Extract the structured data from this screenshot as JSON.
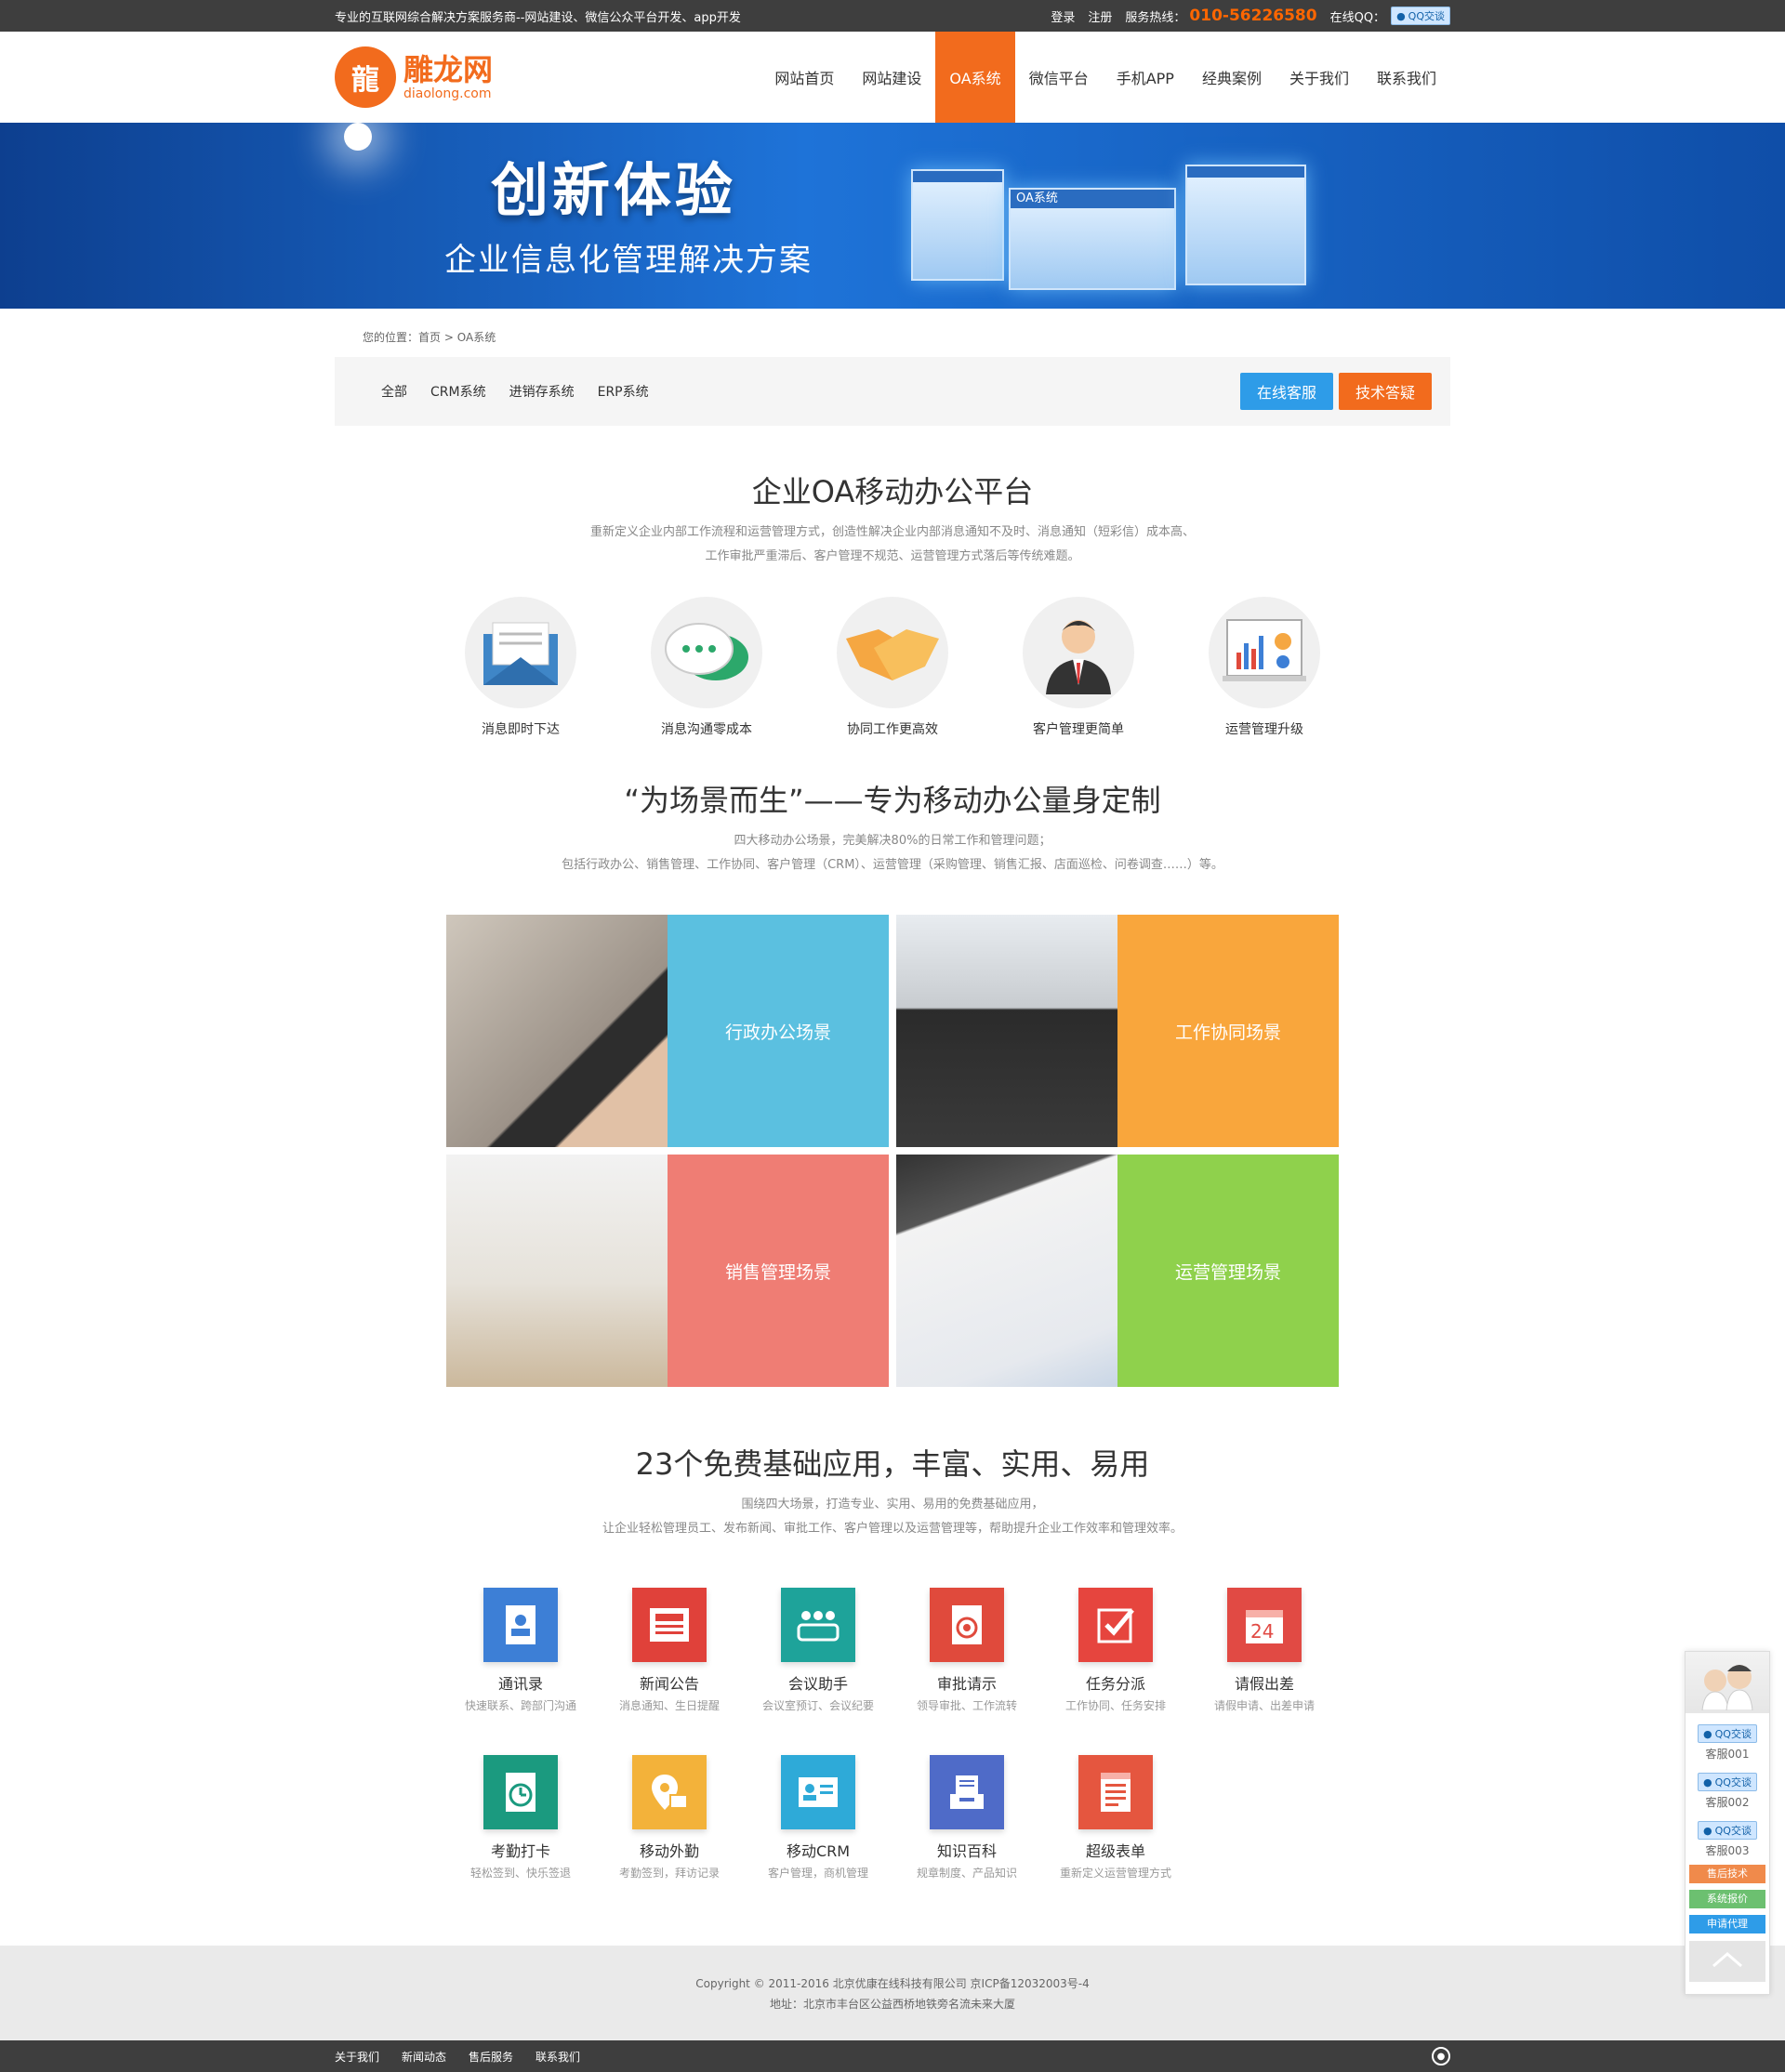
{
  "topbar": {
    "slogan": "专业的互联网综合解决方案服务商--网站建设、微信公众平台开发、app开发",
    "login": "登录",
    "register": "注册",
    "hotline_label": "服务热线：",
    "hotline": "010-56226580",
    "qq_label": "在线QQ：",
    "qq_badge": "QQ交谈"
  },
  "logo": {
    "cn": "雕龙网",
    "en": "diaolong.com"
  },
  "nav": [
    {
      "label": "网站首页"
    },
    {
      "label": "网站建设"
    },
    {
      "label": "OA系统"
    },
    {
      "label": "微信平台"
    },
    {
      "label": "手机APP"
    },
    {
      "label": "经典案例"
    },
    {
      "label": "关于我们"
    },
    {
      "label": "联系我们"
    }
  ],
  "banner": {
    "title": "创新体验",
    "subtitle": "企业信息化管理解决方案",
    "screen_label": "OA系统"
  },
  "breadcrumb": {
    "prefix": "您的位置：",
    "home": "首页",
    "sep": ">",
    "current": "OA系统"
  },
  "tabs": [
    {
      "label": "全部"
    },
    {
      "label": "CRM系统"
    },
    {
      "label": "进销存系统"
    },
    {
      "label": "ERP系统"
    }
  ],
  "buttons": {
    "online_service": "在线客服",
    "tech_support": "技术答疑"
  },
  "section1": {
    "title": "企业OA移动办公平台",
    "desc1": "重新定义企业内部工作流程和运营管理方式，创造性解决企业内部消息通知不及时、消息通知（短彩信）成本高、",
    "desc2": "工作审批严重滞后、客户管理不规范、运营管理方式落后等传统难题。"
  },
  "features": [
    {
      "label": "消息即时下达",
      "icon": "envelope-icon"
    },
    {
      "label": "消息沟通零成本",
      "icon": "chat-bubble-icon"
    },
    {
      "label": "协同工作更高效",
      "icon": "handshake-icon"
    },
    {
      "label": "客户管理更简单",
      "icon": "businessman-icon"
    },
    {
      "label": "运营管理升级",
      "icon": "report-chart-icon"
    }
  ],
  "section2": {
    "title": "“为场景而生”——专为移动办公量身定制",
    "desc1": "四大移动办公场景，完美解决80%的日常工作和管理问题；",
    "desc2": "包括行政办公、销售管理、工作协同、客户管理（CRM）、运营管理（采购管理、销售汇报、店面巡检、问卷调查……）等。"
  },
  "scenes": [
    {
      "label": "行政办公场景",
      "color": "#5bc0e0",
      "photo": "phone-in-hand"
    },
    {
      "label": "工作协同场景",
      "color": "#f9a63c",
      "photo": "business-couple"
    },
    {
      "label": "销售管理场景",
      "color": "#ef7d74",
      "photo": "meeting-room"
    },
    {
      "label": "运营管理场景",
      "color": "#8fd14c",
      "photo": "pen-and-report"
    }
  ],
  "section3": {
    "title": "23个免费基础应用，丰富、实用、易用",
    "desc1": "围绕四大场景，打造专业、实用、易用的免费基础应用，",
    "desc2": "让企业轻松管理员工、发布新闻、审批工作、客户管理以及运营管理等，帮助提升企业工作效率和管理效率。"
  },
  "apps": [
    {
      "name": "通讯录",
      "sub": "快速联系、跨部门沟通",
      "color": "#3d7fd6",
      "icon": "contacts-icon"
    },
    {
      "name": "新闻公告",
      "sub": "消息通知、生日提醒",
      "color": "#e0413a",
      "icon": "news-icon"
    },
    {
      "name": "会议助手",
      "sub": "会议室预订、会议纪要",
      "color": "#1ea39a",
      "icon": "meeting-icon"
    },
    {
      "name": "审批请示",
      "sub": "领导审批、工作流转",
      "color": "#e04a3c",
      "icon": "approval-icon"
    },
    {
      "name": "任务分派",
      "sub": "工作协同、任务安排",
      "color": "#e6453e",
      "icon": "task-check-icon"
    },
    {
      "name": "请假出差",
      "sub": "请假申请、出差申请",
      "color": "#e14a44",
      "icon": "leave-calendar-icon"
    },
    {
      "name": "考勤打卡",
      "sub": "轻松签到、快乐签退",
      "color": "#1b9a7f",
      "icon": "clock-in-icon"
    },
    {
      "name": "移动外勤",
      "sub": "考勤签到，拜访记录",
      "color": "#f3b23a",
      "icon": "location-briefcase-icon"
    },
    {
      "name": "移动CRM",
      "sub": "客户管理，商机管理",
      "color": "#2eaad8",
      "icon": "crm-card-icon"
    },
    {
      "name": "知识百科",
      "sub": "规章制度、产品知识",
      "color": "#4f6bc8",
      "icon": "knowledge-tray-icon"
    },
    {
      "name": "超级表单",
      "sub": "重新定义运营管理方式",
      "color": "#e5563f",
      "icon": "form-icon"
    }
  ],
  "footer": {
    "copyright": "Copyright © 2011-2016 北京优康在线科技有限公司 京ICP备12032003号-4",
    "address": "地址：北京市丰台区公益西桥地铁旁名流未来大厦"
  },
  "bottombar": [
    {
      "label": "关于我们"
    },
    {
      "label": "新闻动态"
    },
    {
      "label": "售后服务"
    },
    {
      "label": "联系我们"
    }
  ],
  "side": {
    "kf": [
      {
        "badge": "QQ交谈",
        "name": "客服001"
      },
      {
        "badge": "QQ交谈",
        "name": "客服002"
      },
      {
        "badge": "QQ交谈",
        "name": "客服003"
      }
    ],
    "btn_after_sales": "售后技术",
    "btn_quote": "系统报价",
    "btn_agent": "申请代理"
  }
}
